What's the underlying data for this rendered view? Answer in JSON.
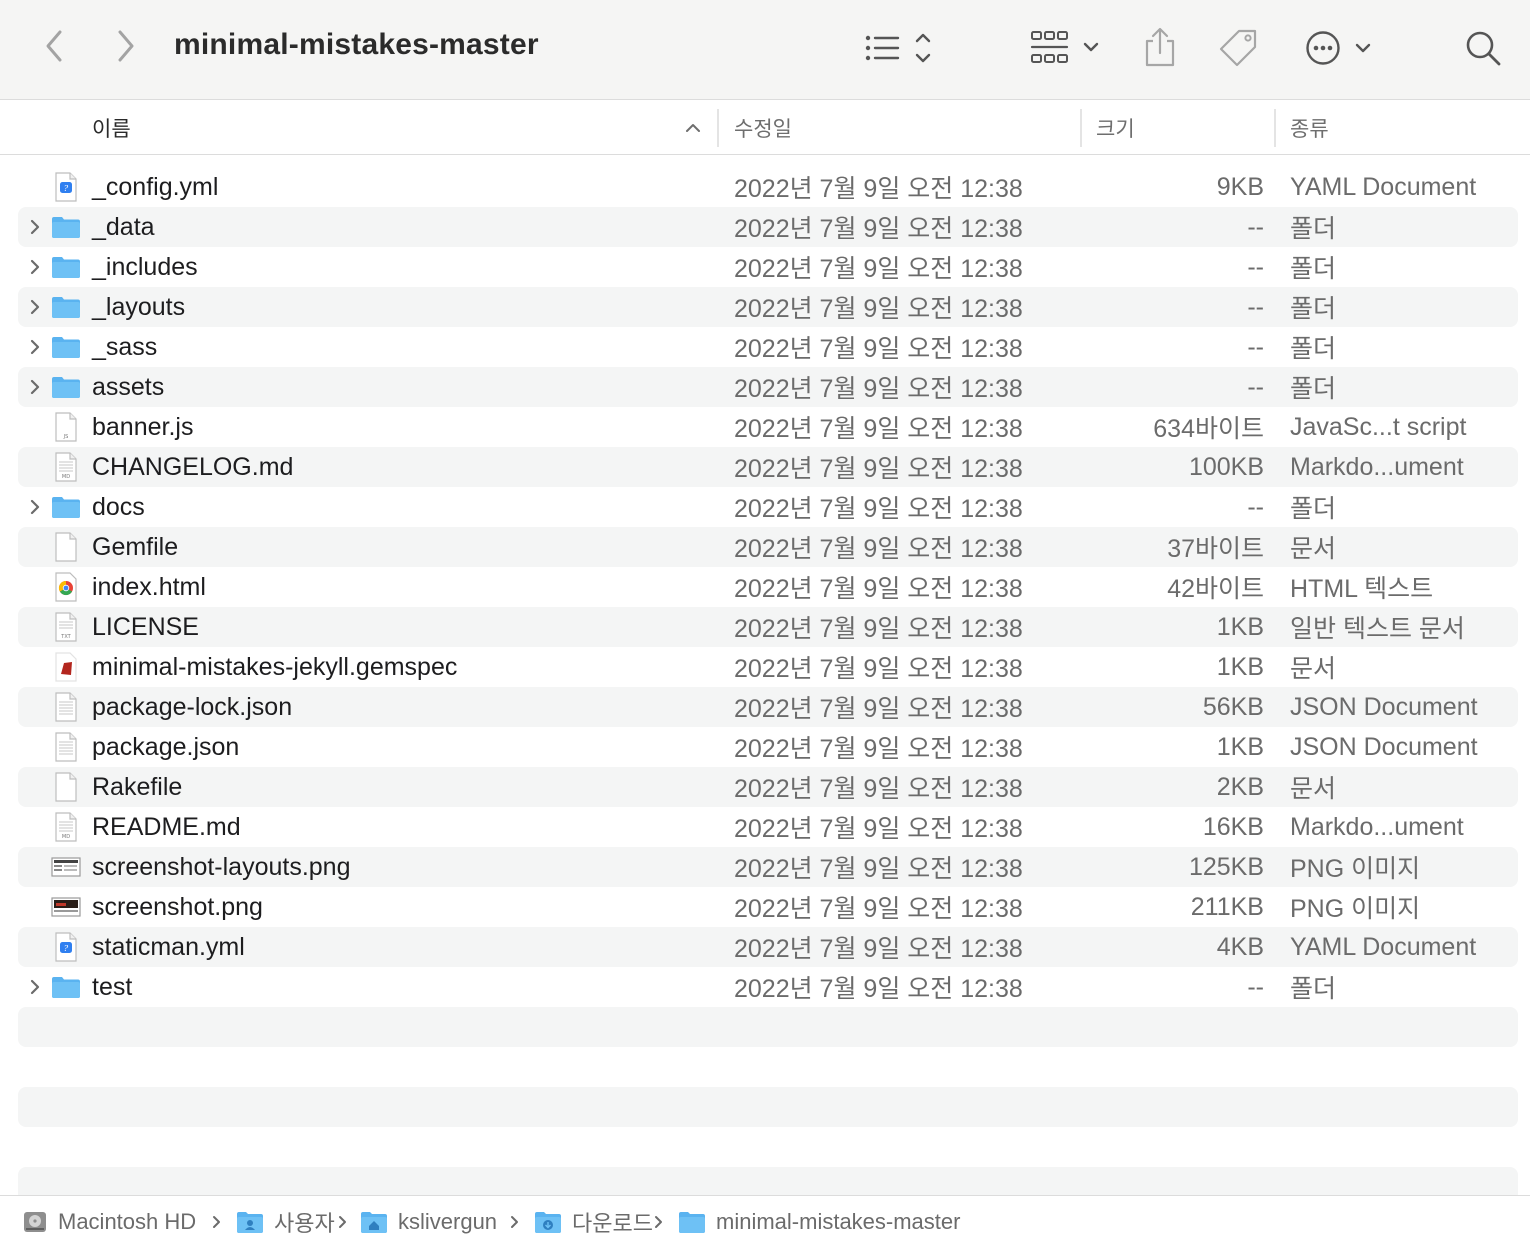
{
  "window": {
    "title": "minimal-mistakes-master"
  },
  "toolbar": {
    "back_icon": "chevron-left-icon",
    "forward_icon": "chevron-right-icon",
    "view_icon": "list-view-icon",
    "group_icon": "grid-group-icon",
    "share_icon": "share-icon",
    "tag_icon": "tag-icon",
    "more_icon": "ellipsis-circle-icon",
    "search_icon": "search-icon"
  },
  "columns": {
    "name": "이름",
    "date": "수정일",
    "size": "크기",
    "kind": "종류"
  },
  "files": [
    {
      "name": "_config.yml",
      "date": "2022년 7월 9일 오전 12:38",
      "size": "9KB",
      "kind": "YAML Document",
      "type": "yml",
      "folder": false
    },
    {
      "name": "_data",
      "date": "2022년 7월 9일 오전 12:38",
      "size": "--",
      "kind": "폴더",
      "type": "folder",
      "folder": true
    },
    {
      "name": "_includes",
      "date": "2022년 7월 9일 오전 12:38",
      "size": "--",
      "kind": "폴더",
      "type": "folder",
      "folder": true
    },
    {
      "name": "_layouts",
      "date": "2022년 7월 9일 오전 12:38",
      "size": "--",
      "kind": "폴더",
      "type": "folder",
      "folder": true
    },
    {
      "name": "_sass",
      "date": "2022년 7월 9일 오전 12:38",
      "size": "--",
      "kind": "폴더",
      "type": "folder",
      "folder": true
    },
    {
      "name": "assets",
      "date": "2022년 7월 9일 오전 12:38",
      "size": "--",
      "kind": "폴더",
      "type": "folder",
      "folder": true
    },
    {
      "name": "banner.js",
      "date": "2022년 7월 9일 오전 12:38",
      "size": "634바이트",
      "kind": "JavaSc...t script",
      "type": "js",
      "folder": false
    },
    {
      "name": "CHANGELOG.md",
      "date": "2022년 7월 9일 오전 12:38",
      "size": "100KB",
      "kind": "Markdo...ument",
      "type": "md",
      "folder": false
    },
    {
      "name": "docs",
      "date": "2022년 7월 9일 오전 12:38",
      "size": "--",
      "kind": "폴더",
      "type": "folder",
      "folder": true
    },
    {
      "name": "Gemfile",
      "date": "2022년 7월 9일 오전 12:38",
      "size": "37바이트",
      "kind": "문서",
      "type": "blank",
      "folder": false
    },
    {
      "name": "index.html",
      "date": "2022년 7월 9일 오전 12:38",
      "size": "42바이트",
      "kind": "HTML 텍스트",
      "type": "html",
      "folder": false
    },
    {
      "name": "LICENSE",
      "date": "2022년 7월 9일 오전 12:38",
      "size": "1KB",
      "kind": "일반 텍스트 문서",
      "type": "txt",
      "folder": false
    },
    {
      "name": "minimal-mistakes-jekyll.gemspec",
      "date": "2022년 7월 9일 오전 12:38",
      "size": "1KB",
      "kind": "문서",
      "type": "gem",
      "folder": false
    },
    {
      "name": "package-lock.json",
      "date": "2022년 7월 9일 오전 12:38",
      "size": "56KB",
      "kind": "JSON Document",
      "type": "json",
      "folder": false
    },
    {
      "name": "package.json",
      "date": "2022년 7월 9일 오전 12:38",
      "size": "1KB",
      "kind": "JSON Document",
      "type": "json",
      "folder": false
    },
    {
      "name": "Rakefile",
      "date": "2022년 7월 9일 오전 12:38",
      "size": "2KB",
      "kind": "문서",
      "type": "blank",
      "folder": false
    },
    {
      "name": "README.md",
      "date": "2022년 7월 9일 오전 12:38",
      "size": "16KB",
      "kind": "Markdo...ument",
      "type": "md",
      "folder": false
    },
    {
      "name": "screenshot-layouts.png",
      "date": "2022년 7월 9일 오전 12:38",
      "size": "125KB",
      "kind": "PNG 이미지",
      "type": "png-light",
      "folder": false
    },
    {
      "name": "screenshot.png",
      "date": "2022년 7월 9일 오전 12:38",
      "size": "211KB",
      "kind": "PNG 이미지",
      "type": "png-dark",
      "folder": false
    },
    {
      "name": "staticman.yml",
      "date": "2022년 7월 9일 오전 12:38",
      "size": "4KB",
      "kind": "YAML Document",
      "type": "yml",
      "folder": false
    },
    {
      "name": "test",
      "date": "2022년 7월 9일 오전 12:38",
      "size": "--",
      "kind": "폴더",
      "type": "folder",
      "folder": true
    }
  ],
  "pathbar": [
    {
      "label": "Macintosh HD",
      "icon": "hard-drive-icon"
    },
    {
      "label": "사용자",
      "icon": "users-folder-icon"
    },
    {
      "label": "kslivergun",
      "icon": "home-folder-icon"
    },
    {
      "label": "다운로드",
      "icon": "downloads-folder-icon"
    },
    {
      "label": "minimal-mistakes-master",
      "icon": "folder-icon"
    }
  ],
  "colors": {
    "folder": "#5ab3f0",
    "folder_tab": "#6ec1f5",
    "row_stripe": "#f4f5f5",
    "toolbar_bg": "#f5f5f4",
    "secondary_text": "#6b6b6b"
  }
}
